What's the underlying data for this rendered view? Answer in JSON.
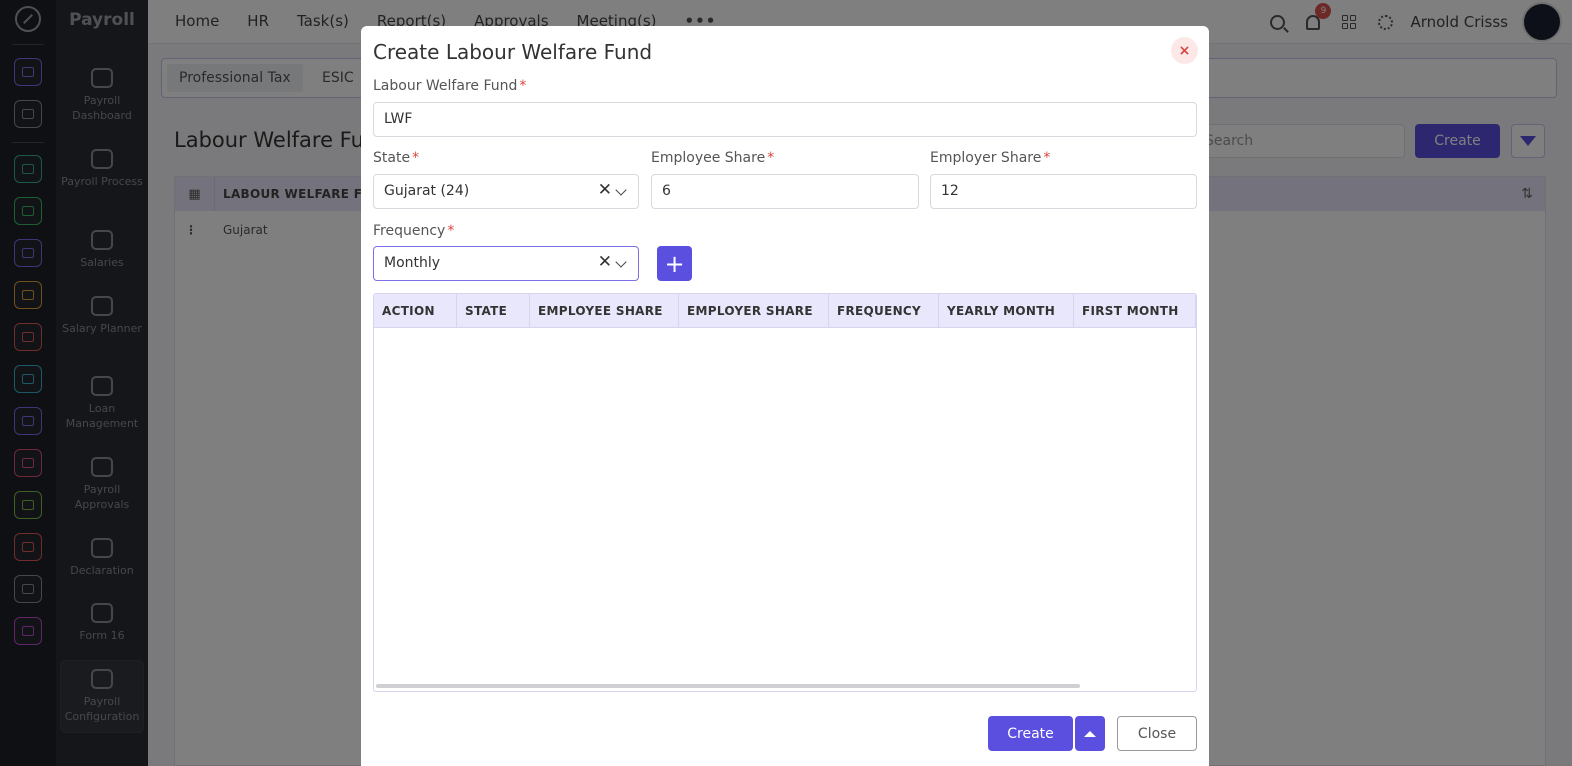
{
  "app": {
    "module_title": "Payroll"
  },
  "topnav": {
    "items": [
      "Home",
      "HR",
      "Task(s)",
      "Report(s)",
      "Approvals",
      "Meeting(s)"
    ],
    "more": "•••"
  },
  "header": {
    "notification_count": "9",
    "user_name": "Arnold Crisss"
  },
  "rail": {
    "icons": [
      {
        "name": "home-icon",
        "color": "#7c6cf0"
      },
      {
        "name": "pin-icon",
        "color": "#8a8f97"
      },
      {
        "name": "people-icon",
        "color": "#3bb08f"
      },
      {
        "name": "money-icon",
        "color": "#3bbf6a"
      },
      {
        "name": "briefcase-icon",
        "color": "#7c6cf0"
      },
      {
        "name": "hand-icon",
        "color": "#e0a23b"
      },
      {
        "name": "target-icon",
        "color": "#e05a5a"
      },
      {
        "name": "archive-icon",
        "color": "#3ab0d0"
      },
      {
        "name": "plane-icon",
        "color": "#7c6cf0"
      },
      {
        "name": "monitor-icon",
        "color": "#e0507a"
      },
      {
        "name": "document-icon",
        "color": "#7cc04a"
      },
      {
        "name": "award-icon",
        "color": "#e05a5a"
      },
      {
        "name": "house-icon",
        "color": "#8a8f97"
      },
      {
        "name": "gear-icon",
        "color": "#c04ad0"
      }
    ]
  },
  "sidebar": {
    "items": [
      {
        "label": "Payroll Dashboard",
        "icon": "dashboard-icon"
      },
      {
        "label": "Payroll Process",
        "icon": "process-icon"
      },
      {
        "label": "Salaries",
        "icon": "salaries-icon"
      },
      {
        "label": "Salary Planner",
        "icon": "planner-icon"
      },
      {
        "label": "Loan Management",
        "icon": "loan-icon"
      },
      {
        "label": "Payroll Approvals",
        "icon": "approvals-icon"
      },
      {
        "label": "Declaration",
        "icon": "declaration-icon"
      },
      {
        "label": "Form 16",
        "icon": "form16-icon"
      },
      {
        "label": "Payroll Configuration",
        "icon": "configuration-icon"
      }
    ]
  },
  "page": {
    "subtabs": [
      "Professional Tax",
      "ESIC"
    ],
    "title": "Labour Welfare Fu",
    "search_placeholder": "Search",
    "create_label": "Create",
    "grid_header": "LABOUR WELFARE FU",
    "grid_rows": [
      "Gujarat"
    ]
  },
  "modal": {
    "title": "Create Labour Welfare Fund",
    "close_icon": "×",
    "fields": {
      "fund_label": "Labour Welfare Fund",
      "fund_value": "LWF",
      "state_label": "State",
      "state_value": "Gujarat (24)",
      "employee_share_label": "Employee Share",
      "employee_share_value": "6",
      "employer_share_label": "Employer Share",
      "employer_share_value": "12",
      "frequency_label": "Frequency",
      "frequency_value": "Monthly",
      "required_mark": "*",
      "clear_mark": "✕"
    },
    "add_label": "+",
    "table": {
      "columns": [
        "ACTION",
        "STATE",
        "EMPLOYEE SHARE",
        "EMPLOYER SHARE",
        "FREQUENCY",
        "YEARLY MONTH",
        "FIRST MONTH"
      ]
    },
    "buttons": {
      "create": "Create",
      "close": "Close"
    }
  }
}
